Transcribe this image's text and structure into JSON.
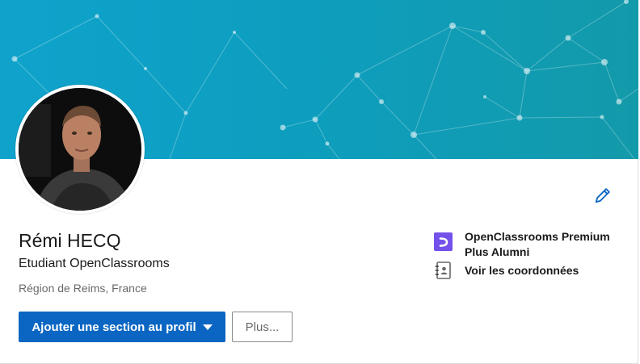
{
  "banner": {
    "colors": {
      "start": "#0fa3cc",
      "end": "#139aaa"
    }
  },
  "profile": {
    "name": "Rémi HECQ",
    "headline": "Etudiant OpenClassrooms",
    "location": "Région de Reims, France",
    "avatar_icon": "profile-photo"
  },
  "actions": {
    "add_section_label": "Ajouter une section au profil",
    "more_label": "Plus..."
  },
  "sidebar": {
    "education": {
      "label": "OpenClassrooms Premium Plus Alumni",
      "icon": "openclassrooms-logo"
    },
    "contact": {
      "label": "Voir les coordonnées",
      "icon": "address-book-icon"
    }
  },
  "icons": {
    "edit": "pencil-icon"
  },
  "colors": {
    "primary_button": "#0a66c2",
    "oc_purple": "#7451eb",
    "edit_icon": "#0a66c2"
  }
}
